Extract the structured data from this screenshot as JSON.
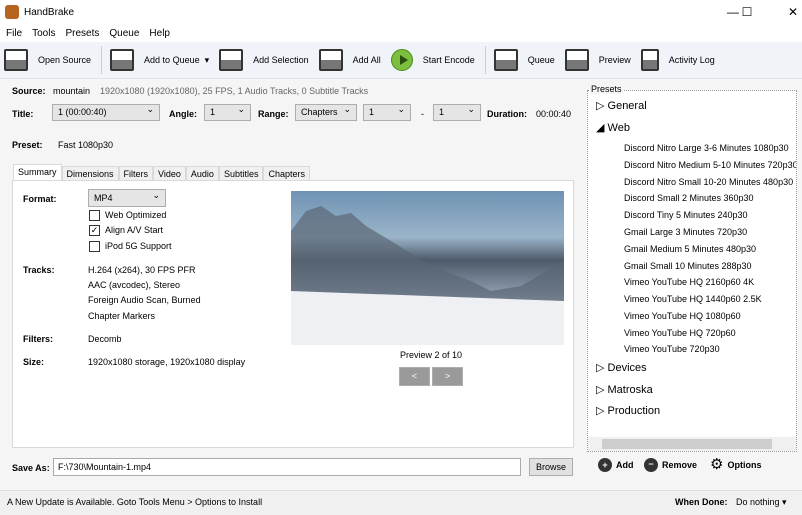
{
  "window": {
    "title": "HandBrake",
    "minimize": "—",
    "maximize": "☐",
    "close": "✕"
  },
  "menu": [
    "File",
    "Tools",
    "Presets",
    "Queue",
    "Help"
  ],
  "toolbar": {
    "open_source": "Open Source",
    "add_to_queue": "Add to Queue",
    "add_selection": "Add Selection",
    "add_all": "Add All",
    "start_encode": "Start Encode",
    "queue": "Queue",
    "preview": "Preview",
    "activity_log": "Activity Log"
  },
  "source": {
    "label": "Source:",
    "name": "mountain",
    "info": "1920x1080 (1920x1080), 25 FPS, 1 Audio Tracks, 0 Subtitle Tracks"
  },
  "title_row": {
    "title_label": "Title:",
    "title_value": "1 (00:00:40)",
    "angle_label": "Angle:",
    "angle_value": "1",
    "range_label": "Range:",
    "range_value": "Chapters",
    "range_start": "1",
    "dash": "-",
    "range_end": "1",
    "duration_label": "Duration:",
    "duration_value": "00:00:40"
  },
  "preset": {
    "label": "Preset:",
    "value": "Fast 1080p30"
  },
  "tabs": [
    "Summary",
    "Dimensions",
    "Filters",
    "Video",
    "Audio",
    "Subtitles",
    "Chapters"
  ],
  "summary": {
    "format_label": "Format:",
    "format_value": "MP4",
    "web_optimized": "Web Optimized",
    "align_av": "Align A/V Start",
    "ipod": "iPod 5G Support",
    "tracks_label": "Tracks:",
    "tracks": [
      "H.264 (x264), 30 FPS PFR",
      "AAC (avcodec), Stereo",
      "Foreign Audio Scan, Burned",
      "Chapter Markers"
    ],
    "filters_label": "Filters:",
    "filters_value": "Decomb",
    "size_label": "Size:",
    "size_value": "1920x1080 storage, 1920x1080 display",
    "preview_caption": "Preview 2 of 10",
    "prev": "<",
    "next": ">"
  },
  "save": {
    "label": "Save As:",
    "value": "F:\\730\\Mountain-1.mp4",
    "browse": "Browse"
  },
  "presets": {
    "title": "Presets",
    "groups": [
      "General",
      "Web",
      "Devices",
      "Matroska",
      "Production"
    ],
    "web_items": [
      "Discord Nitro Large 3-6 Minutes 1080p30",
      "Discord Nitro Medium 5-10 Minutes 720p30",
      "Discord Nitro Small 10-20 Minutes 480p30",
      "Discord Small 2 Minutes 360p30",
      "Discord Tiny 5 Minutes 240p30",
      "Gmail Large 3 Minutes 720p30",
      "Gmail Medium 5 Minutes 480p30",
      "Gmail Small 10 Minutes 288p30",
      "Vimeo YouTube HQ 2160p60 4K",
      "Vimeo YouTube HQ 1440p60 2.5K",
      "Vimeo YouTube HQ 1080p60",
      "Vimeo YouTube HQ 720p60",
      "Vimeo YouTube 720p30"
    ],
    "add": "Add",
    "remove": "Remove",
    "options": "Options"
  },
  "status": {
    "message": "A New Update is Available. Goto Tools Menu > Options to Install",
    "when_done_label": "When Done:",
    "when_done_value": "Do nothing"
  }
}
